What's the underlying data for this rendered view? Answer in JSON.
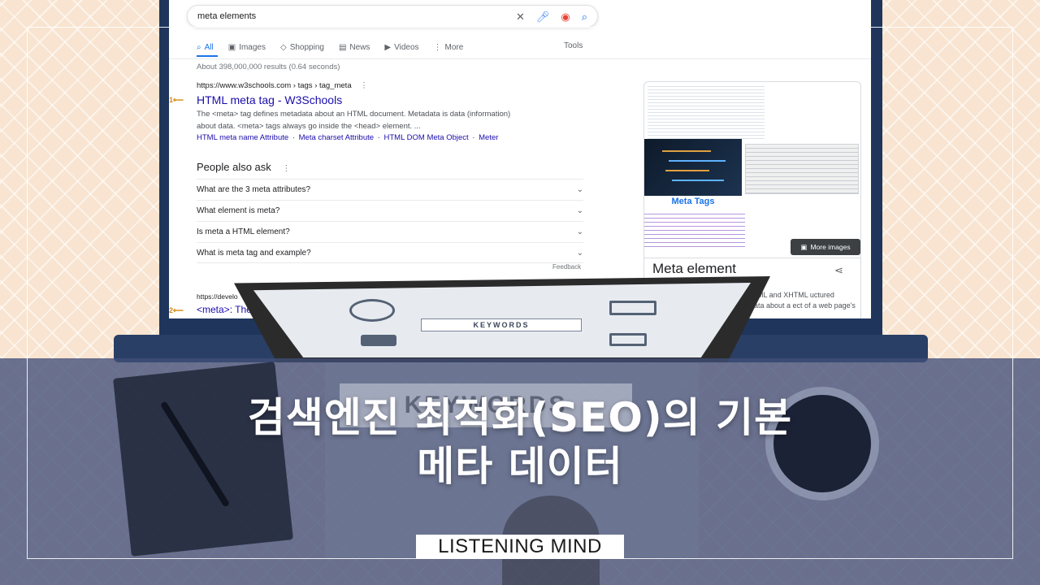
{
  "search": {
    "query": "meta elements",
    "clear_icon": "close-icon",
    "voice_icon": "mic-icon",
    "lens_icon": "camera-icon",
    "search_icon": "search-icon"
  },
  "tabs": [
    {
      "label": "All",
      "icon": "search-icon",
      "active": true
    },
    {
      "label": "Images",
      "icon": "image-icon"
    },
    {
      "label": "Shopping",
      "icon": "tag-icon"
    },
    {
      "label": "News",
      "icon": "news-icon"
    },
    {
      "label": "Videos",
      "icon": "video-icon"
    },
    {
      "label": "More",
      "icon": "more-icon"
    }
  ],
  "tools_label": "Tools",
  "results_stats": "About 398,000,000 results (0.64 seconds)",
  "result1": {
    "marker": "1",
    "cite": "https://www.w3schools.com › tags › tag_meta",
    "title": "HTML meta tag - W3Schools",
    "snippet_line1": "The <meta> tag defines metadata about an HTML document. Metadata is data (information)",
    "snippet_line2": "about data. <meta> tags always go inside the <head> element. ...",
    "sitelinks": [
      "HTML meta name Attribute",
      "Meta charset Attribute",
      "HTML DOM Meta Object",
      "Meter"
    ],
    "sitelink_sep": " · "
  },
  "people_also_ask": {
    "heading": "People also ask",
    "questions": [
      "What are the 3 meta attributes?",
      "What element is meta?",
      "Is meta a HTML element?",
      "What is meta tag and example?"
    ],
    "feedback": "Feedback"
  },
  "result2": {
    "marker": "2",
    "cite": "https://develo",
    "title": "<meta>: The"
  },
  "knowledge_panel": {
    "image_label": "Meta Tags",
    "more_images": "More images",
    "title": "Meta element",
    "share_icon": "share-icon",
    "description": "d in HTML and XHTML uctured metadata about a  ect of a web page's head"
  },
  "tablet": {
    "keywords": "KEYWORDS"
  },
  "overlay": {
    "keywords_bg": "KEYWORDS",
    "headline_line1": "검색엔진 최적화(SEO)의 기본",
    "headline_line2": "메타 데이터",
    "brand": "LISTENING MIND"
  },
  "colors": {
    "link": "#1a0dab",
    "accent": "#1a73e8",
    "overlay": "#404e78",
    "laptop": "#1f355c"
  }
}
